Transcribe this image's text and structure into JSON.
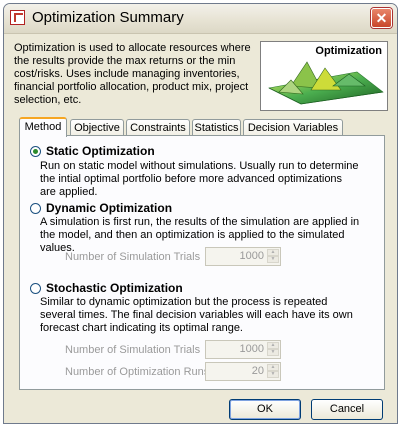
{
  "window": {
    "title": "Optimization Summary"
  },
  "description": "Optimization is used to allocate resources where the results provide the max returns or the min cost/risks. Uses include managing inventories, financial portfolio allocation, product mix, project selection, etc.",
  "thumbnail": {
    "title": "Optimization"
  },
  "tabs": [
    "Method",
    "Objective",
    "Constraints",
    "Statistics",
    "Decision Variables"
  ],
  "options": {
    "static": {
      "label": "Static Optimization",
      "text": "Run on static model without simulations. Usually run to determine the intial optimal portfolio before more advanced optimizations are applied.",
      "checked": true
    },
    "dynamic": {
      "label": "Dynamic Optimization",
      "text": "A simulation is first run, the results of the simulation are applied in the model, and then an optimization is applied to the simulated values.",
      "trials_label": "Number of Simulation Trials",
      "trials_value": "1000"
    },
    "stochastic": {
      "label": "Stochastic Optimization",
      "text": "Similar to dynamic optimization but the process is repeated several times. The final decision variables will each have its own forecast chart indicating its optimal range.",
      "trials_label": "Number of Simulation Trials",
      "trials_value": "1000",
      "runs_label": "Number of Optimization Runs",
      "runs_value": "20"
    }
  },
  "buttons": {
    "ok": "OK",
    "cancel": "Cancel"
  },
  "close_glyph": "✕"
}
